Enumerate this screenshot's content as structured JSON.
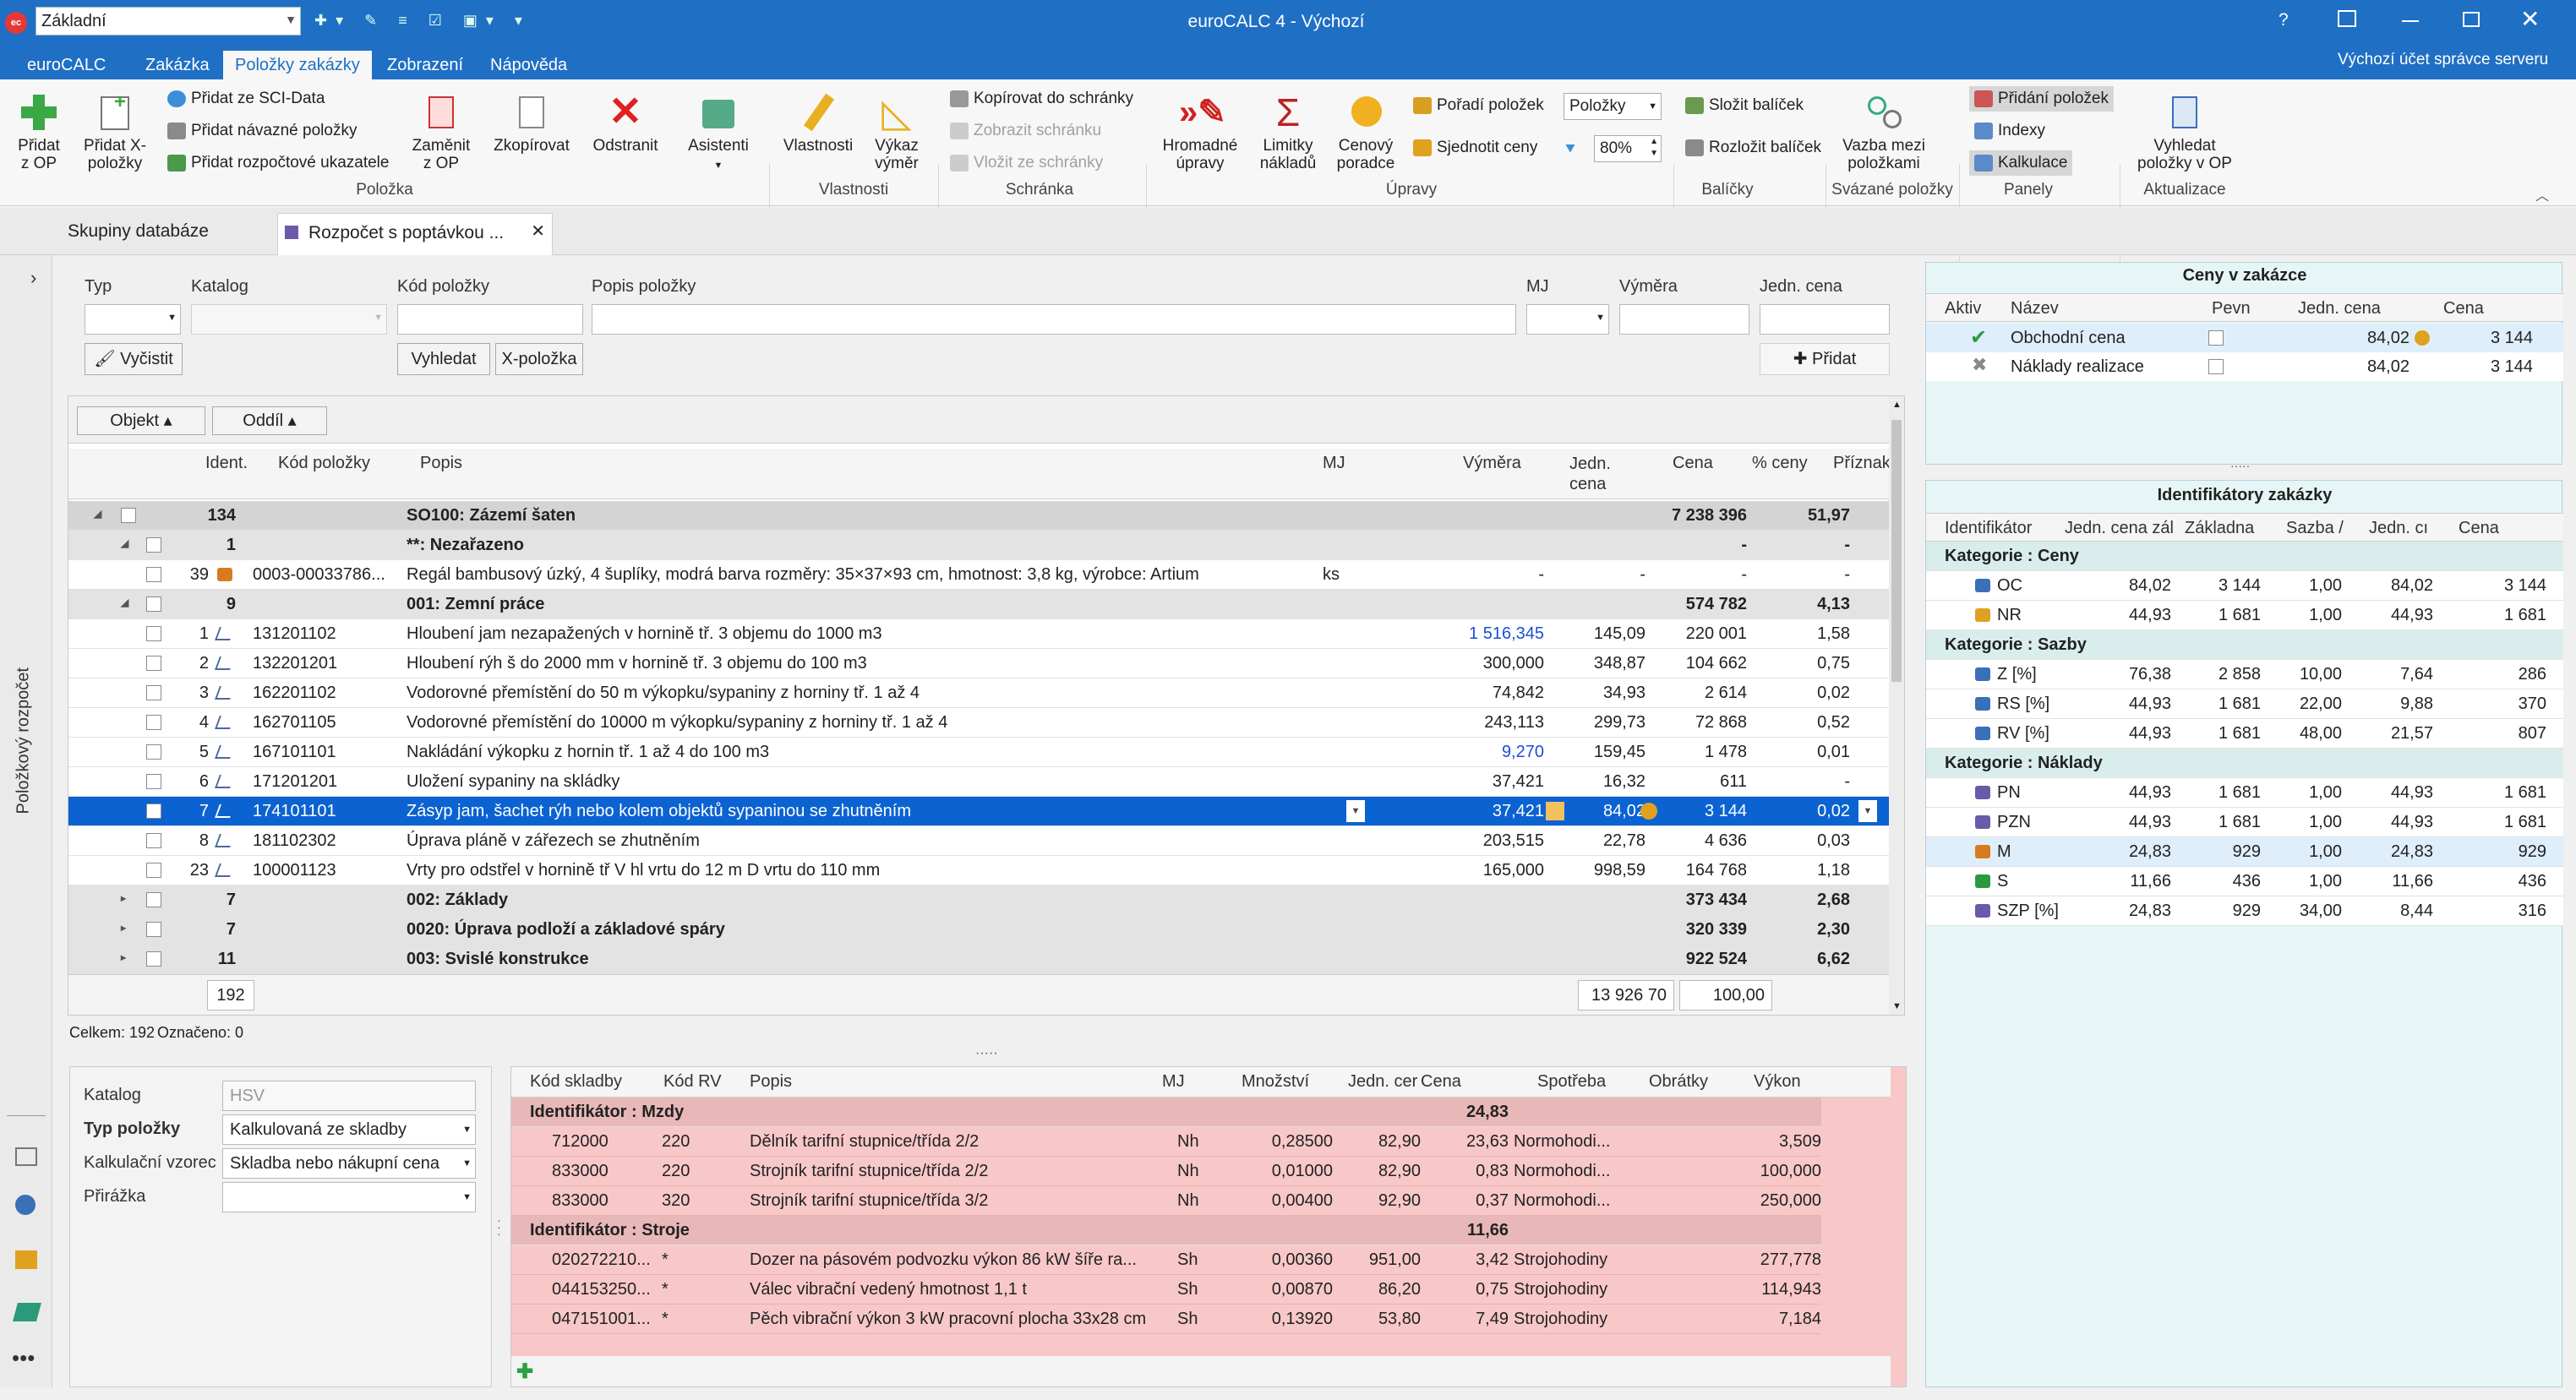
{
  "window": {
    "title": "euroCALC 4 - Výchozí",
    "combo": "Základní",
    "help": "?",
    "user": "Výchozí účet správce serveru"
  },
  "menu": {
    "items": [
      "euroCALC",
      "Zakázka",
      "Položky zakázky",
      "Zobrazení",
      "Nápověda"
    ],
    "active": 2
  },
  "ribbon": {
    "pridat_op": "Přidat z OP",
    "pridat_x": "Přidat X-položky",
    "sci": "Přidat ze SCI-Data",
    "navazne": "Přidat návazné položky",
    "rozpoctove": "Přidat rozpočtové ukazatele",
    "zamenit": "Zaměnit z OP",
    "zkopirovat": "Zkopírovat",
    "odstranit": "Odstranit",
    "asistenti": "Asistenti",
    "group_polozka": "Položka",
    "vlastnosti": "Vlastnosti",
    "vykaz": "Výkaz výměr",
    "group_vlastnosti": "Vlastnosti",
    "kopirovat": "Kopírovat do schránky",
    "zobrazit": "Zobrazit schránku",
    "vlozit": "Vložit ze schránky",
    "group_schranka": "Schránka",
    "hromadne": "Hromadné úpravy",
    "limity": "Limitky nákladů",
    "cenovy": "Cenový poradce",
    "poradi": "Pořadí položek",
    "sjednotit": "Sjednotit ceny",
    "polozky_combo": "Položky",
    "percent": "80%",
    "group_upravy": "Úpravy",
    "slozit": "Složit balíček",
    "rozlozit": "Rozložit balíček",
    "group_balicky": "Balíčky",
    "vazba": "Vazba mezi položkami",
    "group_svazane": "Svázané položky",
    "pridani": "Přidání položek",
    "indexy": "Indexy",
    "kalkulace": "Kalkulace",
    "group_panely": "Panely",
    "vyhledat_op": "Vyhledat položky v OP",
    "group_aktualizace": "Aktualizace"
  },
  "doctabs": [
    "Skupiny databáze",
    "Rozpočet s poptávkou ..."
  ],
  "sidebar_label": "Položkový rozpočet",
  "filter": {
    "typ": "Typ",
    "katalog": "Katalog",
    "kod": "Kód položky",
    "popis": "Popis položky",
    "mj": "MJ",
    "vymera": "Výměra",
    "jcena": "Jedn. cena",
    "vycistit": "Vyčistit",
    "vyhledat": "Vyhledat",
    "xpolozka": "X-položka",
    "pridat": "Přidat"
  },
  "grouping": {
    "objekt": "Objekt",
    "oddil": "Oddíl"
  },
  "grid": {
    "headers": {
      "ident": "Ident.",
      "kod": "Kód položky",
      "popis": "Popis",
      "mj": "MJ",
      "vymera": "Výměra",
      "jcena": "Jedn. cena",
      "cena": "Cena",
      "pct": "% ceny",
      "priznak": "Příznak"
    },
    "rows": [
      {
        "t": "g1",
        "id": "134",
        "kod": "",
        "popis": "SO100: Zázemí šaten",
        "mj": "",
        "vym": "",
        "jc": "",
        "cena": "7 238 396",
        "pct": "51,97"
      },
      {
        "t": "g2",
        "id": "1",
        "kod": "",
        "popis": "**: Nezařazeno",
        "mj": "",
        "vym": "",
        "jc": "",
        "cena": "-",
        "pct": "-"
      },
      {
        "t": "i",
        "id": "39",
        "kod": "0003-00033786...",
        "popis": "Regál bambusový úzký, 4 šuplíky, modrá barva rozměry: 35×37×93 cm, hmotnost: 3,8 kg, výrobce: Artium",
        "mj": "ks",
        "vym": "-",
        "jc": "-",
        "cena": "-",
        "pct": "-"
      },
      {
        "t": "g2",
        "id": "9",
        "kod": "",
        "popis": "001: Zemní práce",
        "mj": "",
        "vym": "",
        "jc": "",
        "cena": "574 782",
        "pct": "4,13"
      },
      {
        "t": "i",
        "id": "1",
        "kod": "131201102",
        "popis": "Hloubení jam nezapažených v hornině tř. 3 objemu do 1000 m3",
        "mj": "",
        "vym": "1 516,345",
        "jc": "145,09",
        "cena": "220 001",
        "pct": "1,58",
        "blue": true
      },
      {
        "t": "i",
        "id": "2",
        "kod": "132201201",
        "popis": "Hloubení rýh š do 2000 mm v hornině tř. 3 objemu do 100 m3",
        "mj": "",
        "vym": "300,000",
        "jc": "348,87",
        "cena": "104 662",
        "pct": "0,75"
      },
      {
        "t": "i",
        "id": "3",
        "kod": "162201102",
        "popis": "Vodorovné přemístění do 50 m výkopku/sypaniny z horniny tř. 1 až 4",
        "mj": "",
        "vym": "74,842",
        "jc": "34,93",
        "cena": "2 614",
        "pct": "0,02"
      },
      {
        "t": "i",
        "id": "4",
        "kod": "162701105",
        "popis": "Vodorovné přemístění do 10000 m výkopku/sypaniny z horniny tř. 1 až 4",
        "mj": "",
        "vym": "243,113",
        "jc": "299,73",
        "cena": "72 868",
        "pct": "0,52"
      },
      {
        "t": "i",
        "id": "5",
        "kod": "167101101",
        "popis": "Nakládání výkopku z hornin tř. 1 až 4 do 100 m3",
        "mj": "",
        "vym": "9,270",
        "jc": "159,45",
        "cena": "1 478",
        "pct": "0,01",
        "blue": true
      },
      {
        "t": "i",
        "id": "6",
        "kod": "171201201",
        "popis": "Uložení sypaniny na skládky",
        "mj": "",
        "vym": "37,421",
        "jc": "16,32",
        "cena": "611",
        "pct": "-"
      },
      {
        "t": "s",
        "id": "7",
        "kod": "174101101",
        "popis": "Zásyp jam, šachet rýh nebo kolem objektů sypaninou se zhutněním",
        "mj": "",
        "vym": "37,421",
        "jc": "84,02",
        "cena": "3 144",
        "pct": "0,02"
      },
      {
        "t": "i",
        "id": "8",
        "kod": "181102302",
        "popis": "Úprava pláně v zářezech se zhutněním",
        "mj": "",
        "vym": "203,515",
        "jc": "22,78",
        "cena": "4 636",
        "pct": "0,03"
      },
      {
        "t": "i",
        "id": "23",
        "kod": "100001123",
        "popis": "Vrty pro odstřel v hornině tř V hl vrtu do 12 m D vrtu do 110 mm",
        "mj": "",
        "vym": "165,000",
        "jc": "998,59",
        "cena": "164 768",
        "pct": "1,18"
      },
      {
        "t": "g2",
        "id": "7",
        "kod": "",
        "popis": "002: Základy",
        "mj": "",
        "vym": "",
        "jc": "",
        "cena": "373 434",
        "pct": "2,68"
      },
      {
        "t": "g2",
        "id": "7",
        "kod": "",
        "popis": "0020: Úprava podloží a základové spáry",
        "mj": "",
        "vym": "",
        "jc": "",
        "cena": "320 339",
        "pct": "2,30"
      },
      {
        "t": "g2",
        "id": "11",
        "kod": "",
        "popis": "003: Svislé konstrukce",
        "mj": "",
        "vym": "",
        "jc": "",
        "cena": "922 524",
        "pct": "6,62"
      }
    ],
    "footer_count": "192",
    "footer_total": "13 926 70",
    "footer_pct": "100,00"
  },
  "status": {
    "celkem": "Celkem: 192",
    "oznaceno": "Označeno: 0"
  },
  "props": {
    "katalog_l": "Katalog",
    "katalog_v": "HSV",
    "typ_l": "Typ položky",
    "typ_v": "Kalkulovaná ze skladby",
    "vzorec_l": "Kalkulační vzorec",
    "vzorec_v": "Skladba nebo nákupní cena",
    "prirazka_l": "Přirážka",
    "prirazka_v": ""
  },
  "skladba": {
    "headers": {
      "kod": "Kód skladby",
      "rv": "Kód RV",
      "popis": "Popis",
      "mj": "MJ",
      "mnozstvi": "Množství",
      "jcena": "Jedn. cer",
      "cena": "Cena",
      "spotreba": "Spotřeba",
      "obratky": "Obrátky",
      "vykon": "Výkon"
    },
    "groups": [
      {
        "title": "Identifikátor : Mzdy",
        "sum": "24,83",
        "rows": [
          {
            "kod": "712000",
            "rv": "220",
            "popis": "Dělník tarifní stupnice/třída 2/2",
            "mj": "Nh",
            "mn": "0,28500",
            "jc": "82,90",
            "cena": "23,63",
            "sp": "Normohodi...",
            "vyk": "3,509"
          },
          {
            "kod": "833000",
            "rv": "220",
            "popis": "Strojník tarifní stupnice/třída 2/2",
            "mj": "Nh",
            "mn": "0,01000",
            "jc": "82,90",
            "cena": "0,83",
            "sp": "Normohodi...",
            "vyk": "100,000"
          },
          {
            "kod": "833000",
            "rv": "320",
            "popis": "Strojník tarifní stupnice/třída 3/2",
            "mj": "Nh",
            "mn": "0,00400",
            "jc": "92,90",
            "cena": "0,37",
            "sp": "Normohodi...",
            "vyk": "250,000"
          }
        ]
      },
      {
        "title": "Identifikátor : Stroje",
        "sum": "11,66",
        "rows": [
          {
            "kod": "020272210...",
            "rv": "*",
            "popis": "Dozer na pásovém podvozku výkon 86 kW šíře ra...",
            "mj": "Sh",
            "mn": "0,00360",
            "jc": "951,00",
            "cena": "3,42",
            "sp": "Strojohodiny",
            "vyk": "277,778"
          },
          {
            "kod": "044153250...",
            "rv": "*",
            "popis": "Válec vibrační vedený hmotnost 1,1 t",
            "mj": "Sh",
            "mn": "0,00870",
            "jc": "86,20",
            "cena": "0,75",
            "sp": "Strojohodiny",
            "vyk": "114,943"
          },
          {
            "kod": "047151001...",
            "rv": "*",
            "popis": "Pěch vibrační výkon 3 kW pracovní plocha 33x28 cm",
            "mj": "Sh",
            "mn": "0,13920",
            "jc": "53,80",
            "cena": "7,49",
            "sp": "Strojohodiny",
            "vyk": "7,184"
          }
        ]
      }
    ]
  },
  "ceny": {
    "title": "Ceny v zakázce",
    "headers": {
      "aktiv": "Aktiv",
      "nazev": "Název",
      "pevn": "Pevn",
      "jcena": "Jedn. cena",
      "cena": "Cena"
    },
    "rows": [
      {
        "nazev": "Obchodní cena",
        "jc": "84,02",
        "cena": "3 144"
      },
      {
        "nazev": "Náklady realizace",
        "jc": "84,02",
        "cena": "3 144"
      }
    ]
  },
  "ident": {
    "title": "Identifikátory zakázky",
    "headers": {
      "id": "Identifikátor",
      "jcz": "Jedn. cena zál",
      "zakl": "Základna",
      "sazba": "Sazba /",
      "jc": "Jedn. cı",
      "cena": "Cena"
    },
    "groups": [
      {
        "title": "Kategorie : Ceny",
        "rows": [
          {
            "n": "OC",
            "a": "84,02",
            "b": "3 144",
            "c": "1,00",
            "d": "84,02",
            "e": "3 144"
          },
          {
            "n": "NR",
            "a": "44,93",
            "b": "1 681",
            "c": "1,00",
            "d": "44,93",
            "e": "1 681"
          }
        ]
      },
      {
        "title": "Kategorie : Sazby",
        "rows": [
          {
            "n": "Z [%]",
            "a": "76,38",
            "b": "2 858",
            "c": "10,00",
            "d": "7,64",
            "e": "286"
          },
          {
            "n": "RS [%]",
            "a": "44,93",
            "b": "1 681",
            "c": "22,00",
            "d": "9,88",
            "e": "370"
          },
          {
            "n": "RV [%]",
            "a": "44,93",
            "b": "1 681",
            "c": "48,00",
            "d": "21,57",
            "e": "807"
          }
        ]
      },
      {
        "title": "Kategorie : Náklady",
        "rows": [
          {
            "n": "PN",
            "a": "44,93",
            "b": "1 681",
            "c": "1,00",
            "d": "44,93",
            "e": "1 681"
          },
          {
            "n": "PZN",
            "a": "44,93",
            "b": "1 681",
            "c": "1,00",
            "d": "44,93",
            "e": "1 681"
          },
          {
            "n": "M",
            "a": "24,83",
            "b": "929",
            "c": "1,00",
            "d": "24,83",
            "e": "929"
          },
          {
            "n": "S",
            "a": "11,66",
            "b": "436",
            "c": "1,00",
            "d": "11,66",
            "e": "436"
          },
          {
            "n": "SZP [%]",
            "a": "24,83",
            "b": "929",
            "c": "34,00",
            "d": "8,44",
            "e": "316"
          }
        ]
      }
    ]
  }
}
